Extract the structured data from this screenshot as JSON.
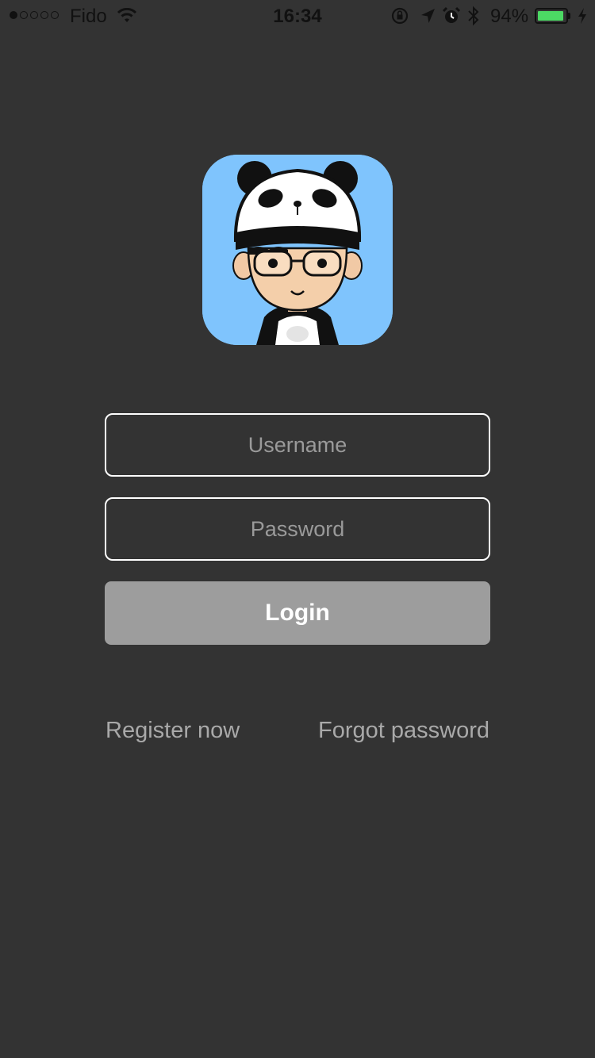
{
  "status_bar": {
    "signal_bars": 5,
    "signal_filled": 1,
    "carrier": "Fido",
    "time": "16:34",
    "battery_percent": "94%",
    "battery_level": 0.94,
    "icons": [
      "wifi-icon",
      "orientation-lock-icon",
      "location-arrow-icon",
      "alarm-clock-icon",
      "bluetooth-icon",
      "battery-icon",
      "charging-bolt-icon"
    ]
  },
  "avatar": {
    "description_icon": "panda-hat-cartoon-avatar-icon",
    "background_color": "#7fc4fd"
  },
  "login_form": {
    "username_placeholder": "Username",
    "username_value": "",
    "password_placeholder": "Password",
    "password_value": "",
    "login_label": "Login"
  },
  "links": {
    "register": "Register now",
    "forgot_password": "Forgot password"
  },
  "colors": {
    "background": "#333333",
    "field_border": "#ffffff",
    "placeholder": "#9a9a9a",
    "button_bg": "#9d9d9d",
    "link_text": "#a9a9a9",
    "battery": "#4cd964"
  }
}
